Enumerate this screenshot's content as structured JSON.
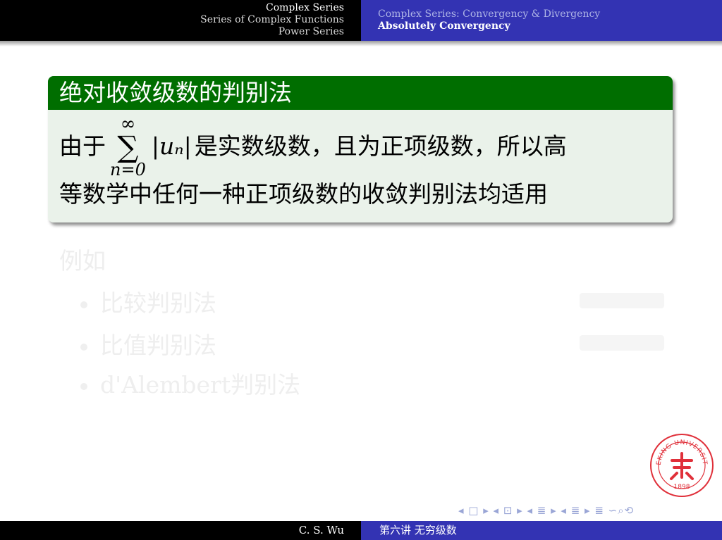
{
  "header": {
    "sections": [
      "Complex Series",
      "Series of Complex Functions",
      "Power Series"
    ],
    "active_section": 0,
    "subsections": [
      "Complex Series: Convergency & Divergency",
      "Absolutely Convergency"
    ],
    "active_subsection": 1
  },
  "block": {
    "title": "绝对收敛级数的判别法",
    "line1_pre": "由于",
    "sum_sup": "∞",
    "sum_sign": "∑",
    "sum_sub": "n=0",
    "abs_expr": "|uₙ|",
    "line1_post": "是实数级数，且为正项级数，所以高",
    "line2": "等数学中任何一种正项级数的收敛判别法均适用"
  },
  "faded": {
    "intro": "例如",
    "items": [
      "比较判别法",
      "比值判别法",
      "d'Alembert判别法"
    ]
  },
  "seal": {
    "text": "PEKING UNIVERSITY",
    "year": "1898",
    "color": "#e0303a"
  },
  "nav": {
    "symbols": "◂ □ ▸ ◂ ⊡ ▸ ◂ ≣ ▸ ◂ ≣ ▸  ≣  ∽⌕⟲"
  },
  "footer": {
    "author": "C. S. Wu",
    "lecture": "第六讲 无穷级数"
  },
  "colors": {
    "header_left": "#000000",
    "header_right": "#3333b3",
    "block_title": "#006e00",
    "block_body": "#eaf2ea"
  }
}
